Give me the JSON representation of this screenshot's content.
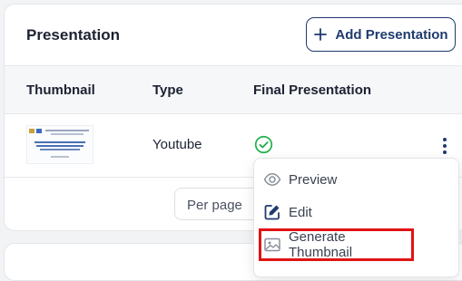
{
  "section": {
    "title": "Presentation",
    "add_button_label": "Add Presentation"
  },
  "table": {
    "columns": [
      "Thumbnail",
      "Type",
      "Final Presentation"
    ],
    "rows": [
      {
        "type": "Youtube",
        "final_presentation": true
      }
    ]
  },
  "pagination": {
    "per_page_label": "Per page"
  },
  "row_menu": {
    "items": [
      {
        "label": "Preview",
        "icon": "eye-icon"
      },
      {
        "label": "Edit",
        "icon": "edit-icon"
      },
      {
        "label": "Generate Thumbnail",
        "icon": "image-icon",
        "highlighted": true
      }
    ]
  },
  "colors": {
    "brand": "#1f3a6e",
    "success": "#22b14c",
    "highlight_border": "#e01414"
  }
}
